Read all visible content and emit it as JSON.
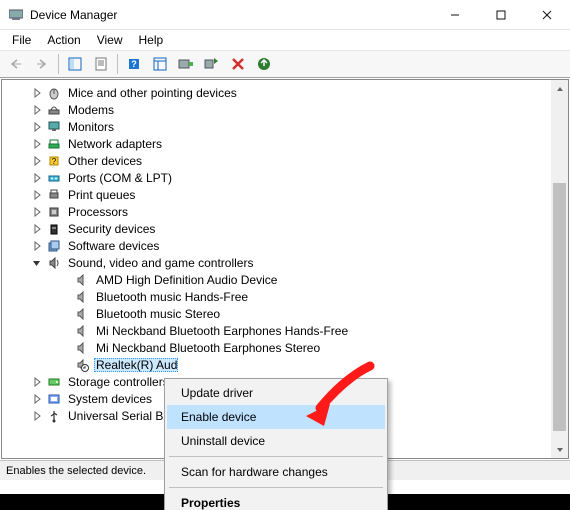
{
  "window": {
    "title": "Device Manager"
  },
  "menubar": {
    "items": [
      "File",
      "Action",
      "View",
      "Help"
    ]
  },
  "toolbar": {
    "buttons": [
      {
        "name": "back-icon",
        "enabled": false
      },
      {
        "name": "forward-icon",
        "enabled": false
      },
      {
        "name": "show-hidden-icon",
        "enabled": true
      },
      {
        "name": "properties-icon",
        "enabled": true
      },
      {
        "name": "help-icon",
        "enabled": true
      },
      {
        "name": "view-icon",
        "enabled": true
      },
      {
        "name": "update-driver-icon",
        "enabled": true
      },
      {
        "name": "enable-device-icon",
        "enabled": true
      },
      {
        "name": "uninstall-icon",
        "enabled": true
      },
      {
        "name": "scan-hardware-icon",
        "enabled": true
      }
    ]
  },
  "tree": {
    "categories": [
      {
        "icon": "mouse-icon",
        "label": "Mice and other pointing devices",
        "expanded": false
      },
      {
        "icon": "modem-icon",
        "label": "Modems",
        "expanded": false
      },
      {
        "icon": "monitor-icon",
        "label": "Monitors",
        "expanded": false
      },
      {
        "icon": "network-icon",
        "label": "Network adapters",
        "expanded": false
      },
      {
        "icon": "other-icon",
        "label": "Other devices",
        "expanded": false
      },
      {
        "icon": "port-icon",
        "label": "Ports (COM & LPT)",
        "expanded": false
      },
      {
        "icon": "printer-icon",
        "label": "Print queues",
        "expanded": false
      },
      {
        "icon": "cpu-icon",
        "label": "Processors",
        "expanded": false
      },
      {
        "icon": "security-icon",
        "label": "Security devices",
        "expanded": false
      },
      {
        "icon": "software-icon",
        "label": "Software devices",
        "expanded": false
      },
      {
        "icon": "sound-icon",
        "label": "Sound, video and game controllers",
        "expanded": true,
        "children": [
          {
            "icon": "speaker-icon",
            "label": "AMD High Definition Audio Device"
          },
          {
            "icon": "speaker-icon",
            "label": "Bluetooth music Hands-Free"
          },
          {
            "icon": "speaker-icon",
            "label": "Bluetooth music Stereo"
          },
          {
            "icon": "speaker-icon",
            "label": "Mi Neckband Bluetooth Earphones Hands-Free"
          },
          {
            "icon": "speaker-icon",
            "label": "Mi Neckband Bluetooth Earphones Stereo"
          },
          {
            "icon": "speaker-disabled-icon",
            "label": "Realtek(R) Audio",
            "selected": true,
            "truncated": true
          }
        ]
      },
      {
        "icon": "storage-icon",
        "label": "Storage controllers",
        "expanded": false,
        "truncated": true
      },
      {
        "icon": "system-icon",
        "label": "System devices",
        "expanded": false
      },
      {
        "icon": "usb-icon",
        "label": "Universal Serial Bus controllers",
        "expanded": false,
        "truncated": true
      }
    ]
  },
  "context_menu": {
    "items": [
      {
        "label": "Update driver",
        "hover": false
      },
      {
        "label": "Enable device",
        "hover": true
      },
      {
        "label": "Uninstall device",
        "hover": false
      },
      {
        "sep": true
      },
      {
        "label": "Scan for hardware changes",
        "hover": false
      },
      {
        "sep": true
      },
      {
        "label": "Properties",
        "bold": true,
        "hover": false
      }
    ]
  },
  "statusbar": {
    "text": "Enables the selected device."
  },
  "annotation": {
    "arrow": "red-arrow-pointing-to-enable-device"
  }
}
